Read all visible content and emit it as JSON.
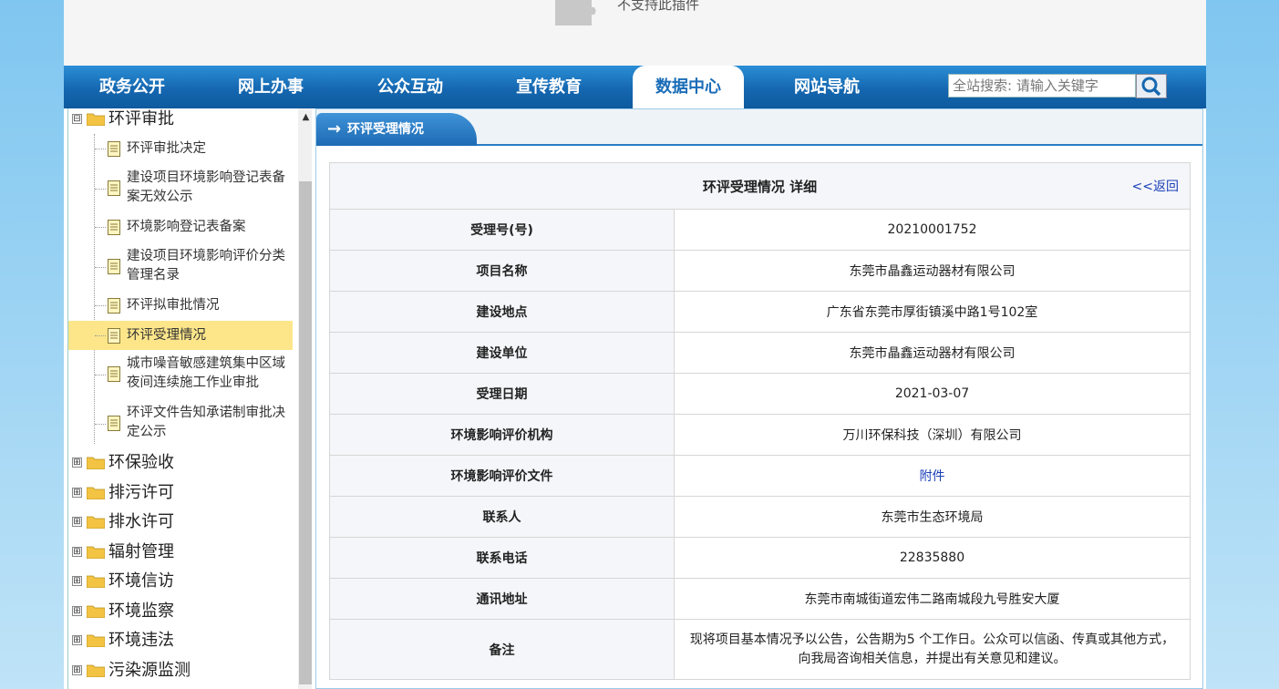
{
  "plugin": {
    "message": "不支持此插件",
    "icon": "puzzle-piece-icon"
  },
  "nav": {
    "items": [
      "政务公开",
      "网上办事",
      "公众互动",
      "宣传教育",
      "数据中心",
      "网站导航"
    ],
    "active": "数据中心",
    "search_placeholder": "全站搜索: 请输入关键字",
    "search_icon": "search-icon"
  },
  "sidebar": {
    "groups": [
      {
        "label": "环评审批",
        "expanded": true,
        "toggle": "⊟",
        "children": [
          "环评审批决定",
          "建设项目环境影响登记表备案无效公示",
          "环境影响登记表备案",
          "建设项目环境影响评价分类管理名录",
          "环评拟审批情况",
          "环评受理情况",
          "城市噪音敏感建筑集中区域夜间连续施工作业审批",
          "环评文件告知承诺制审批决定公示"
        ],
        "selected": "环评受理情况"
      },
      {
        "label": "环保验收",
        "toggle": "⊞"
      },
      {
        "label": "排污许可",
        "toggle": "⊞"
      },
      {
        "label": "排水许可",
        "toggle": "⊞"
      },
      {
        "label": "辐射管理",
        "toggle": "⊞"
      },
      {
        "label": "环境信访",
        "toggle": "⊞"
      },
      {
        "label": "环境监察",
        "toggle": "⊞"
      },
      {
        "label": "环境违法",
        "toggle": "⊞"
      },
      {
        "label": "污染源监测",
        "toggle": "⊞"
      }
    ]
  },
  "main": {
    "tab_label": "环评受理情况",
    "detail_title": "环评受理情况 详细",
    "back_label": "<<返回",
    "rows": [
      {
        "key": "受理号(号)",
        "value": "20210001752"
      },
      {
        "key": "项目名称",
        "value": "东莞市晶鑫运动器材有限公司"
      },
      {
        "key": "建设地点",
        "value": "广东省东莞市厚街镇溪中路1号102室"
      },
      {
        "key": "建设单位",
        "value": "东莞市晶鑫运动器材有限公司"
      },
      {
        "key": "受理日期",
        "value": "2021-03-07"
      },
      {
        "key": "环境影响评价机构",
        "value": "万川环保科技（深圳）有限公司"
      },
      {
        "key": "环境影响评价文件",
        "value": "附件",
        "is_link": true
      },
      {
        "key": "联系人",
        "value": "东莞市生态环境局"
      },
      {
        "key": "联系电话",
        "value": "22835880"
      },
      {
        "key": "通讯地址",
        "value": "东莞市南城街道宏伟二路南城段九号胜安大厦"
      },
      {
        "key": "备注",
        "value": "现将项目基本情况予以公告，公告期为5 个工作日。公众可以信函、传真或其他方式，向我局咨询相关信息，并提出有关意见和建议。"
      }
    ]
  },
  "colors": {
    "nav_blue": "#1567b0",
    "selected_bg": "#fde68a",
    "link": "#1a3fb8"
  }
}
